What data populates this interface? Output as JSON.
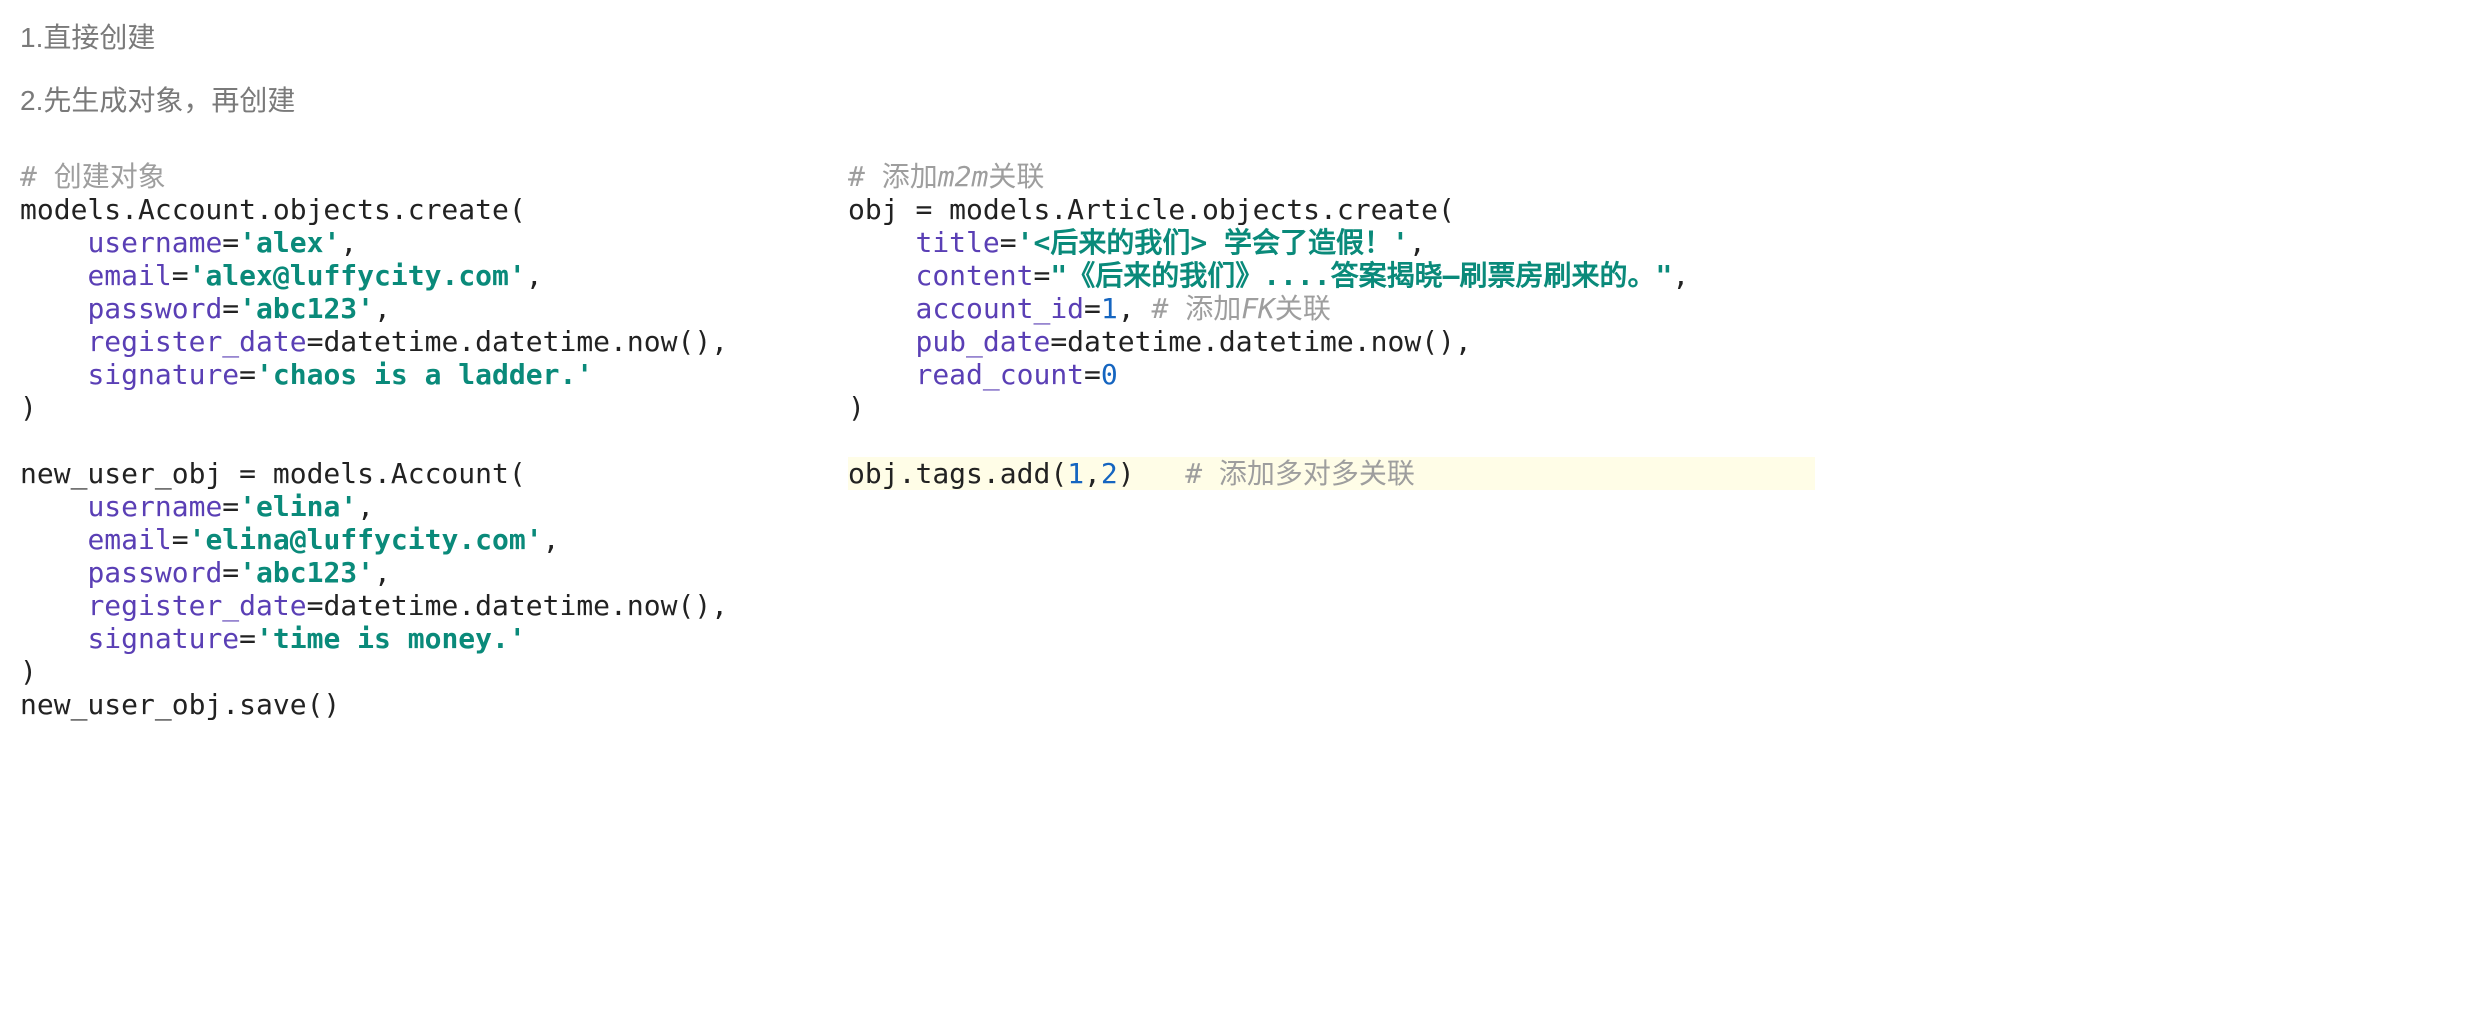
{
  "headings": {
    "h1": "1.直接创建",
    "h2": "2.先生成对象，再创建"
  },
  "left": {
    "c1": "# 创建对象",
    "l1a": "models.Account.objects.create(",
    "l2a": "    ",
    "l2b": "username",
    "l2c": "=",
    "l2d": "'alex'",
    "l2e": ",",
    "l3a": "    ",
    "l3b": "email",
    "l3c": "=",
    "l3d": "'alex@luffycity.com'",
    "l3e": ",",
    "l4a": "    ",
    "l4b": "password",
    "l4c": "=",
    "l4d": "'abc123'",
    "l4e": ",",
    "l5a": "    ",
    "l5b": "register_date",
    "l5c": "=datetime.datetime.now(),",
    "l6a": "    ",
    "l6b": "signature",
    "l6c": "=",
    "l6d": "'chaos is a ladder.'",
    "l7a": ")",
    "blank1": "",
    "l8a": "new_user_obj = models.Account(",
    "l9a": "    ",
    "l9b": "username",
    "l9c": "=",
    "l9d": "'elina'",
    "l9e": ",",
    "l10a": "    ",
    "l10b": "email",
    "l10c": "=",
    "l10d": "'elina@luffycity.com'",
    "l10e": ",",
    "l11a": "    ",
    "l11b": "password",
    "l11c": "=",
    "l11d": "'abc123'",
    "l11e": ",",
    "l12a": "    ",
    "l12b": "register_date",
    "l12c": "=datetime.datetime.now(),",
    "l13a": "    ",
    "l13b": "signature",
    "l13c": "=",
    "l13d": "'time is money.'",
    "l14a": ")",
    "l15a": "new_user_obj.save()"
  },
  "right": {
    "c1a": "# 添加",
    "c1b": "m2m",
    "c1c": "关联",
    "r1a": "obj = models.Article.objects.create(",
    "r2a": "    ",
    "r2b": "title",
    "r2c": "=",
    "r2d": "'<后来的我们> 学会了造假！'",
    "r2e": ",",
    "r3a": "    ",
    "r3b": "content",
    "r3c": "=",
    "r3d": "\"《后来的我们》....答案揭晓—刷票房刷来的。\"",
    "r3e": ",",
    "r4a": "    ",
    "r4b": "account_id",
    "r4c": "=",
    "r4d": "1",
    "r4e": ", ",
    "r4f": "# 添加",
    "r4g": "FK",
    "r4h": "关联",
    "r5a": "    ",
    "r5b": "pub_date",
    "r5c": "=datetime.datetime.now(),",
    "r6a": "    ",
    "r6b": "read_count",
    "r6c": "=",
    "r6d": "0",
    "r7a": ")",
    "blank": "",
    "r8a": "obj.tags.add(",
    "r8b": "1",
    "r8c": ",",
    "r8d": "2",
    "r8e": ")   ",
    "r8f": "# 添加多对多关联"
  }
}
